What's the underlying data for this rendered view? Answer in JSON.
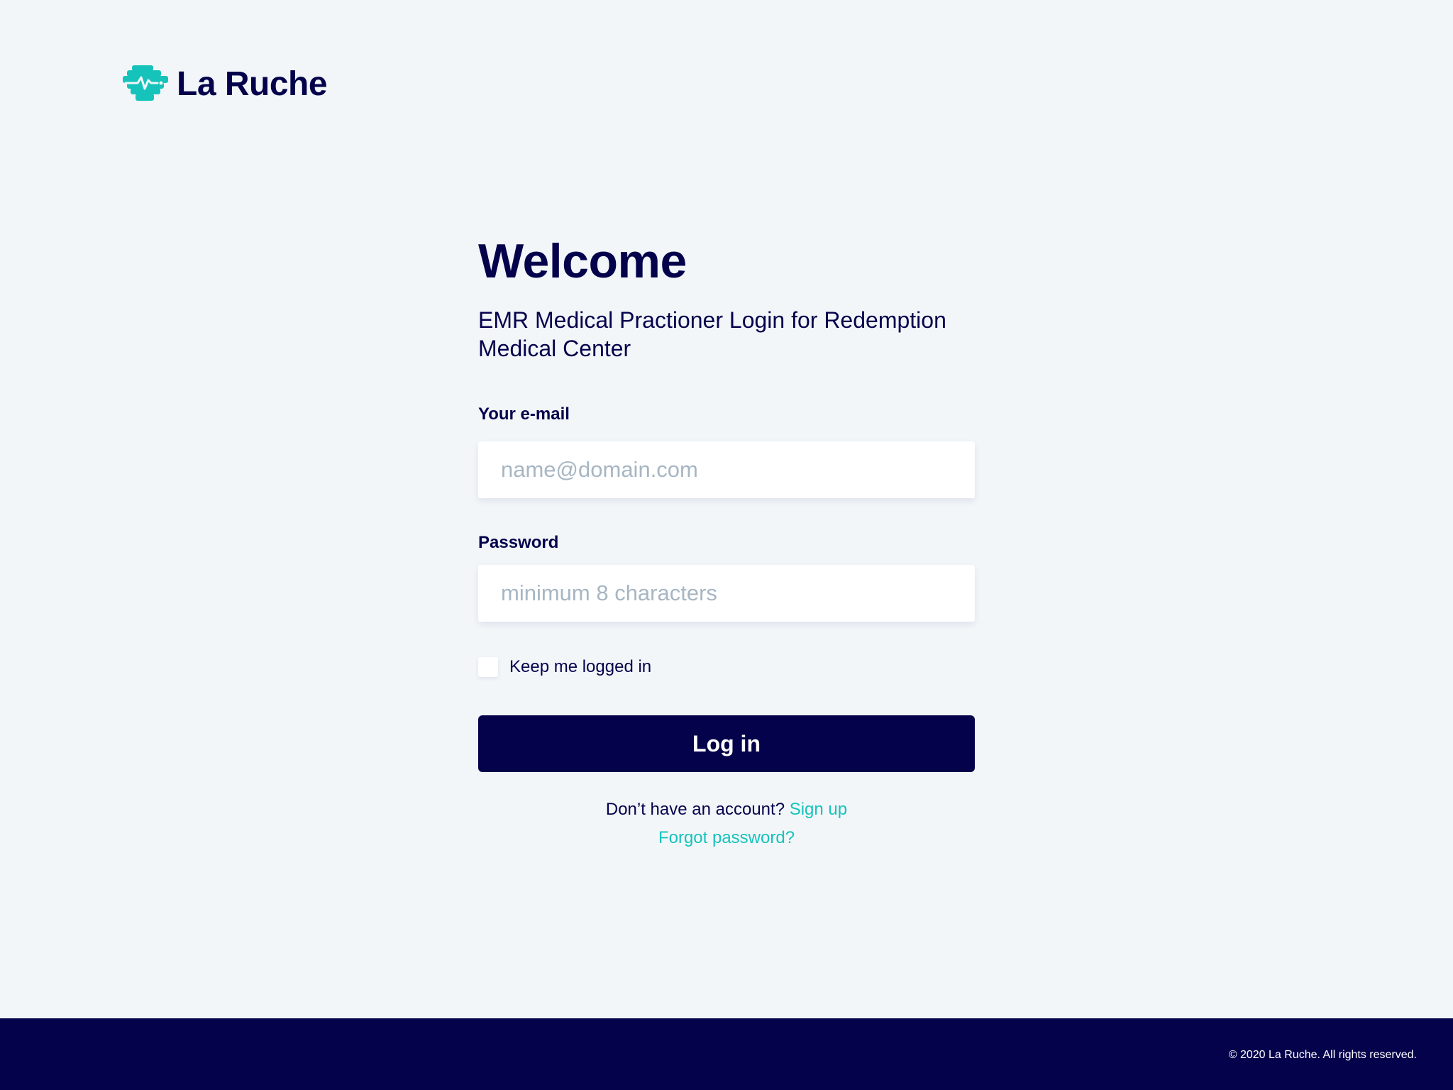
{
  "brand": {
    "name": "La Ruche",
    "logo_icon": "heart-rate-honeycomb-icon",
    "accent_color": "#15c3bb",
    "navy_color": "#05024c"
  },
  "login": {
    "title": "Welcome",
    "subtitle": "EMR Medical Practioner Login for Redemption Medical Center",
    "email": {
      "label": "Your e-mail",
      "value": "",
      "placeholder": "name@domain.com"
    },
    "password": {
      "label": "Password",
      "value": "",
      "placeholder": "minimum 8 characters"
    },
    "remember": {
      "label": "Keep me logged in",
      "checked": false
    },
    "submit_label": "Log in",
    "signup_prompt": "Don’t have an account?",
    "signup_link": "Sign up",
    "forgot_link": "Forgot password?"
  },
  "footer": {
    "copyright": "© 2020 La Ruche. All rights reserved."
  }
}
